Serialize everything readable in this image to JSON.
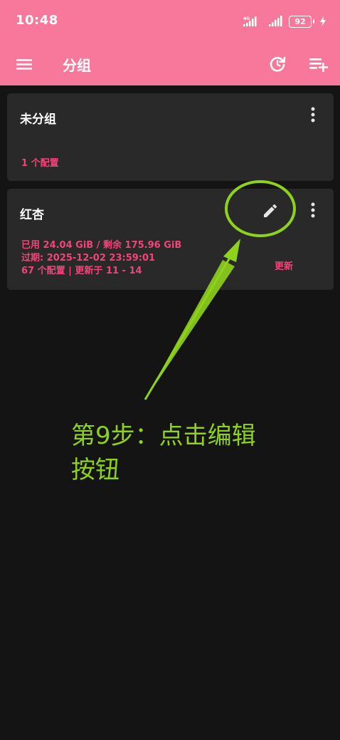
{
  "status_bar": {
    "time": "10:48",
    "network_label": "4G",
    "battery_level": "92"
  },
  "app_bar": {
    "title": "分组",
    "menu_icon": "menu-icon",
    "history_icon": "history-refresh-icon",
    "add_icon": "playlist-add-icon"
  },
  "groups": [
    {
      "name": "未分组",
      "profile_count": "1 个配置"
    },
    {
      "name": "红杏",
      "usage": "已用 24.04 GiB / 剩余 175.96 GiB",
      "expire": "过期: 2025-12-02 23:59:01",
      "summary": "67 个配置 | 更新于 11 - 14",
      "update_label": "更新"
    }
  ],
  "annotation": {
    "line1": "第9步：点击编辑",
    "line2": "按钮"
  },
  "colors": {
    "accent": "#f7789a",
    "pink_text": "#f2447a",
    "background": "#141414",
    "card": "#292929",
    "annotation": "#8ed21c"
  }
}
